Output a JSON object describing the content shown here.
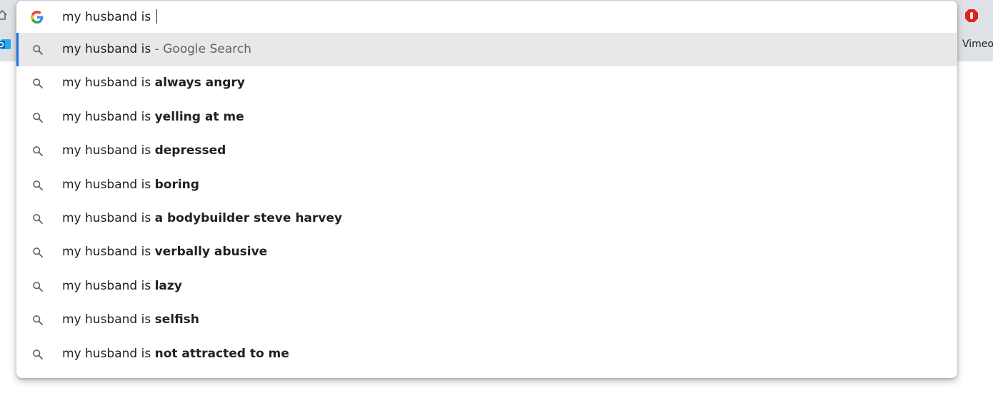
{
  "browser": {
    "bookmark_vimeo": "Vimeo"
  },
  "omnibox": {
    "query": "my husband is ",
    "icon": "google-g-icon"
  },
  "suggestions": [
    {
      "prefix": "my husband is ",
      "bold": "",
      "suffix": "- Google Search",
      "icon": "search-icon",
      "selected": true
    },
    {
      "prefix": "my husband is ",
      "bold": "always angry",
      "suffix": "",
      "icon": "search-icon"
    },
    {
      "prefix": "my husband is ",
      "bold": "yelling at me",
      "suffix": "",
      "icon": "search-icon"
    },
    {
      "prefix": "my husband is ",
      "bold": "depressed",
      "suffix": "",
      "icon": "search-icon"
    },
    {
      "prefix": "my husband is ",
      "bold": "boring",
      "suffix": "",
      "icon": "search-icon"
    },
    {
      "prefix": "my husband is ",
      "bold": "a bodybuilder steve harvey",
      "suffix": "",
      "icon": "search-icon"
    },
    {
      "prefix": "my husband is ",
      "bold": "verbally abusive",
      "suffix": "",
      "icon": "search-icon"
    },
    {
      "prefix": "my husband is ",
      "bold": "lazy",
      "suffix": "",
      "icon": "search-icon"
    },
    {
      "prefix": "my husband is ",
      "bold": "selfish",
      "suffix": "",
      "icon": "search-icon"
    },
    {
      "prefix": "my husband is ",
      "bold": "not attracted to me",
      "suffix": "",
      "icon": "search-icon"
    }
  ],
  "colors": {
    "selection_accent": "#1a73e8",
    "selected_row_bg": "#e8e8e9",
    "adblock_red": "#e0211d"
  }
}
